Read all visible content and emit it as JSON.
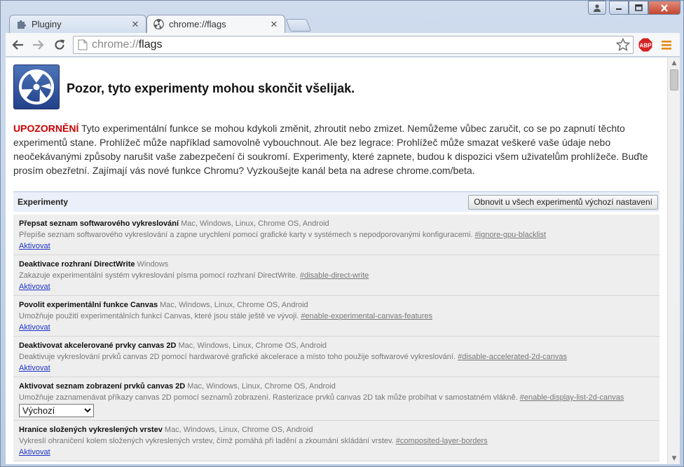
{
  "tabs": [
    {
      "title": "Pluginy",
      "icon": "puzzle-icon",
      "active": false
    },
    {
      "title": "chrome://flags",
      "icon": "radiation-icon",
      "active": true
    }
  ],
  "toolbar": {
    "url_scheme": "chrome://",
    "url_path": "flags",
    "extension_label": "ABP"
  },
  "page": {
    "title": "Pozor, tyto experimenty mohou skončit všelijak.",
    "warning_label": "UPOZORNĚNÍ",
    "warning_text": " Tyto experimentální funkce se mohou kdykoli změnit, zhroutit nebo zmizet. Nemůžeme vůbec zaručit, co se po zapnutí těchto experimentů stane. Prohlížeč může například samovolně vybouchnout. Ale bez legrace: Prohlížeč může smazat veškeré vaše údaje nebo neočekávanými způsoby narušit vaše zabezpečení či soukromí. Experimenty, které zapnete, budou k dispozici všem uživatelům prohlížeče. Buďte prosím obezřetní. Zajímají vás nové funkce Chromu? Vyzkoušejte kanál beta na adrese chrome.com/beta.",
    "experiments_header": "Experimenty",
    "reset_button": "Obnovit u všech experimentů výchozí nastavení"
  },
  "experiments": [
    {
      "name": "Přepsat seznam softwarového vykreslování",
      "platforms": "Mac, Windows, Linux, Chrome OS, Android",
      "desc": "Přepíše seznam softwarového vykreslování a zapne urychlení pomocí grafické karty v systémech s nepodporovanými konfiguracemi.",
      "flag": "#ignore-gpu-blacklist",
      "action": "Aktivovat"
    },
    {
      "name": "Deaktivace rozhraní DirectWrite",
      "platforms": "Windows",
      "desc": "Zakazuje experimentální systém vykreslování písma pomocí rozhraní DirectWrite.",
      "flag": "#disable-direct-write",
      "action": "Aktivovat"
    },
    {
      "name": "Povolit experimentální funkce Canvas",
      "platforms": "Mac, Windows, Linux, Chrome OS, Android",
      "desc": "Umožňuje použití experimentálních funkcí Canvas, které jsou stále ještě ve vývoji.",
      "flag": "#enable-experimental-canvas-features",
      "action": "Aktivovat"
    },
    {
      "name": "Deaktivovat akcelerované prvky canvas 2D",
      "platforms": "Mac, Windows, Linux, Chrome OS, Android",
      "desc": "Deaktivuje vykreslování prvků canvas 2D pomocí hardwarové grafické akcelerace a místo toho použije softwarové vykreslování.",
      "flag": "#disable-accelerated-2d-canvas",
      "action": "Aktivovat"
    },
    {
      "name": "Aktivovat seznam zobrazení prvků canvas 2D",
      "platforms": "Mac, Windows, Linux, Chrome OS, Android",
      "desc": "Umožňuje zaznamenávat příkazy canvas 2D pomocí seznamů zobrazení. Rasterizace prvků canvas 2D tak může probíhat v samostatném vlákně.",
      "flag": "#enable-display-list-2d-canvas",
      "select_value": "Výchozí"
    },
    {
      "name": "Hranice složených vykreslených vrstev",
      "platforms": "Mac, Windows, Linux, Chrome OS, Android",
      "desc": "Vykreslí ohraničení kolem složených vykreslených vrstev, čímž pomáhá při ladění a zkoumání skládání vrstev.",
      "flag": "#composited-layer-borders",
      "action": "Aktivovat"
    }
  ],
  "colors": {
    "warning": "#cc0000",
    "link": "#1d34c8",
    "icon_bg": "#2f55a0"
  }
}
